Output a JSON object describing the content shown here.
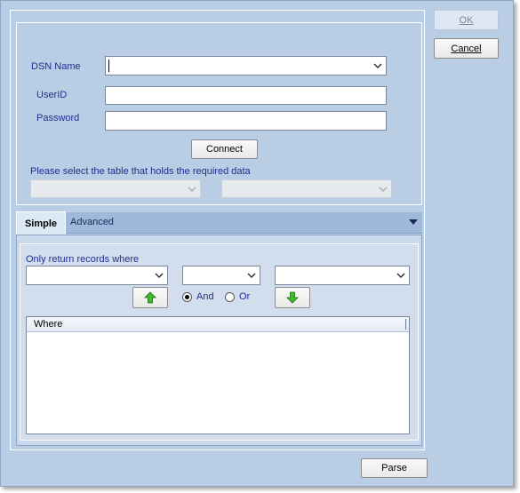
{
  "buttons": {
    "ok": "OK",
    "cancel": "Cancel",
    "connect": "Connect",
    "parse": "Parse"
  },
  "connection": {
    "dsn_label": "DSN Name",
    "dsn_value": "",
    "userid_label": "UserID",
    "userid_value": "",
    "password_label": "Password",
    "password_value": "",
    "table_prompt": "Please select the table that holds the required data"
  },
  "tabs": {
    "simple": "Simple",
    "advanced": "Advanced",
    "active": "Simple"
  },
  "filter": {
    "prompt": "Only return records where",
    "field_value": "",
    "operator_value": "",
    "value_value": "",
    "and_label": "And",
    "or_label": "Or",
    "selected_logic": "And"
  },
  "grid": {
    "column_header": "Where"
  },
  "icons": {
    "move_up": "green-up-arrow-icon",
    "move_down": "green-down-arrow-icon",
    "dropdown": "chevron-down-icon"
  }
}
